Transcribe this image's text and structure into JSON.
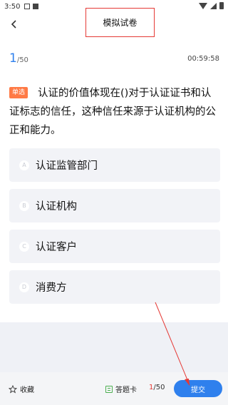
{
  "status_bar": {
    "time": "3:50"
  },
  "header": {
    "title": "模拟试卷"
  },
  "progress": {
    "current": "1",
    "total": "/50",
    "timer": "00:59:58"
  },
  "question": {
    "type_badge": "单选",
    "text": "认证的价值体现在()对于认证证书和认证标志的信任，这种信任来源于认证机构的公正和能力。"
  },
  "options": [
    {
      "letter": "A",
      "text": "认证监管部门"
    },
    {
      "letter": "B",
      "text": "认证机构"
    },
    {
      "letter": "C",
      "text": "认证客户"
    },
    {
      "letter": "D",
      "text": "消费方"
    }
  ],
  "bottom_bar": {
    "favorite_label": "收藏",
    "answer_card_label": "答题卡",
    "progress_current": "1",
    "progress_total": "/50",
    "submit_label": "提交"
  },
  "colors": {
    "accent": "#2f80ed",
    "badge": "#ff7a45",
    "annotation": "#e53935"
  },
  "icons": [
    "back-arrow-icon",
    "star-outline-icon",
    "answer-card-icon"
  ]
}
